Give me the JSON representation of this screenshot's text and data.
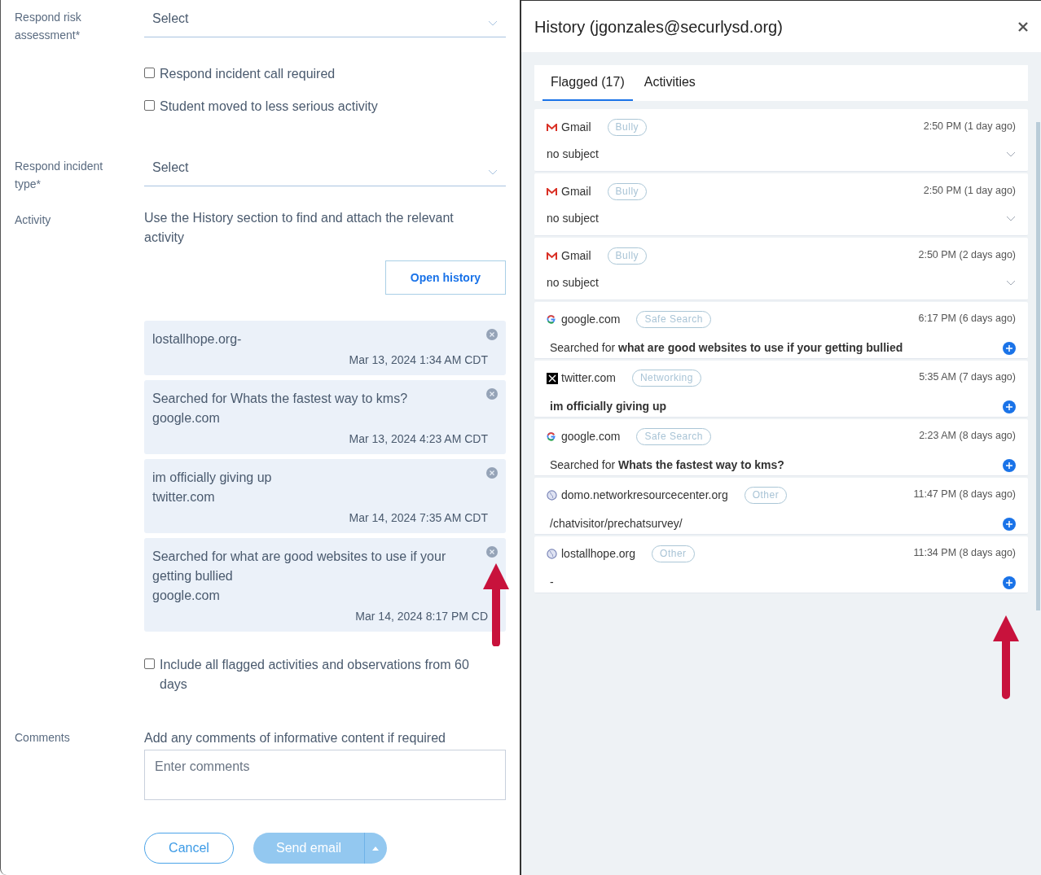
{
  "form": {
    "risk": {
      "label": "Respond risk assessment*",
      "value": "Select"
    },
    "checkboxes": [
      {
        "label": "Respond incident call required",
        "checked": false
      },
      {
        "label": "Student moved to less serious activity",
        "checked": false
      }
    ],
    "incident_type": {
      "label": "Respond incident type*",
      "value": "Select"
    },
    "activity": {
      "label": "Activity",
      "instruction": "Use the History section to find and attach the relevant activity",
      "button": "Open history"
    },
    "attached": [
      {
        "lines": [
          "lostallhope.org-"
        ],
        "timestamp": "Mar 13, 2024 1:34 AM CDT"
      },
      {
        "lines": [
          "Searched for Whats the fastest way to kms?",
          "google.com"
        ],
        "timestamp": "Mar 13, 2024 4:23 AM CDT"
      },
      {
        "lines": [
          "im officially giving up",
          "twitter.com"
        ],
        "timestamp": "Mar 14, 2024 7:35 AM CDT"
      },
      {
        "lines": [
          "Searched for what are good websites to use if your getting bullied",
          "google.com"
        ],
        "timestamp": "Mar 14, 2024 8:17 PM CD"
      }
    ],
    "include": {
      "label": "Include all flagged activities and observations from 60 days",
      "checked": false
    },
    "comments": {
      "label": "Comments",
      "hint": "Add any comments of informative content if required",
      "placeholder": "Enter comments"
    },
    "cancel": "Cancel",
    "send": "Send email"
  },
  "history": {
    "title": "History (jgonzales@securlysd.org)",
    "tabs": [
      {
        "label": "Flagged (17)",
        "selected": true
      },
      {
        "label": "Activities",
        "selected": false
      }
    ],
    "items": [
      {
        "kind": "gmail",
        "source": "Gmail",
        "tag": "Bully",
        "time": "2:50 PM (1 day ago)",
        "text": "no subject",
        "expandable": true
      },
      {
        "kind": "gmail",
        "source": "Gmail",
        "tag": "Bully",
        "time": "2:50 PM (1 day ago)",
        "text": "no subject",
        "expandable": true
      },
      {
        "kind": "gmail",
        "source": "Gmail",
        "tag": "Bully",
        "time": "2:50 PM (2 days ago)",
        "text": "no subject",
        "expandable": true
      },
      {
        "kind": "google",
        "source": "google.com",
        "tag": "Safe Search",
        "time": "6:17 PM (6 days ago)",
        "text": "Searched for **what are good websites to use if your getting bullied**",
        "expandable": false
      },
      {
        "kind": "x",
        "source": "twitter.com",
        "tag": "Networking",
        "time": "5:35 AM (7 days ago)",
        "text": "**im officially giving up**",
        "expandable": false
      },
      {
        "kind": "google",
        "source": "google.com",
        "tag": "Safe Search",
        "time": "2:23 AM (8 days ago)",
        "text": "Searched for **Whats the fastest way to kms?**",
        "expandable": false
      },
      {
        "kind": "globe",
        "source": "domo.networkresourcecenter.org",
        "tag": "Other",
        "time": "11:47 PM (8 days ago)",
        "text": "/chatvisitor/prechatsurvey/",
        "expandable": false
      },
      {
        "kind": "globe",
        "source": "lostallhope.org",
        "tag": "Other",
        "time": "11:34 PM (8 days ago)",
        "text": "-",
        "expandable": false
      }
    ]
  }
}
